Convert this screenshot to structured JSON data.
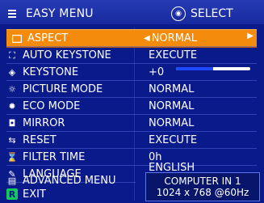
{
  "header": {
    "title": "EASY MENU",
    "select_hint": "SELECT"
  },
  "items": [
    {
      "icon": "aspect-icon",
      "label": "ASPECT",
      "value": "NORMAL"
    },
    {
      "icon": "keystone-auto-icon",
      "label": "AUTO KEYSTONE",
      "value": "EXECUTE"
    },
    {
      "icon": "keystone-icon",
      "label": "KEYSTONE",
      "value": "+0"
    },
    {
      "icon": "picture-mode-icon",
      "label": "PICTURE MODE",
      "value": "NORMAL"
    },
    {
      "icon": "eco-mode-icon",
      "label": "ECO MODE",
      "value": "NORMAL"
    },
    {
      "icon": "mirror-icon",
      "label": "MIRROR",
      "value": "NORMAL"
    },
    {
      "icon": "reset-icon",
      "label": "RESET",
      "value": "EXECUTE"
    },
    {
      "icon": "filter-time-icon",
      "label": "FILTER TIME",
      "value": "0h"
    },
    {
      "icon": "language-icon",
      "label": "LANGUAGE",
      "value": "ENGLISH"
    },
    {
      "icon": "advanced-menu-icon",
      "label": "ADVANCED MENU",
      "value": ""
    },
    {
      "icon": "exit-icon",
      "label": "EXIT",
      "value": ""
    }
  ],
  "keystone_level": 0.5,
  "status": {
    "line1": "COMPUTER IN 1",
    "line2": "1024 x 768 @60Hz"
  },
  "colors": {
    "background": "#0a1a8a",
    "header": "#17299e",
    "highlight": "#f48b0d",
    "slider_fill": "#1e49ff"
  }
}
